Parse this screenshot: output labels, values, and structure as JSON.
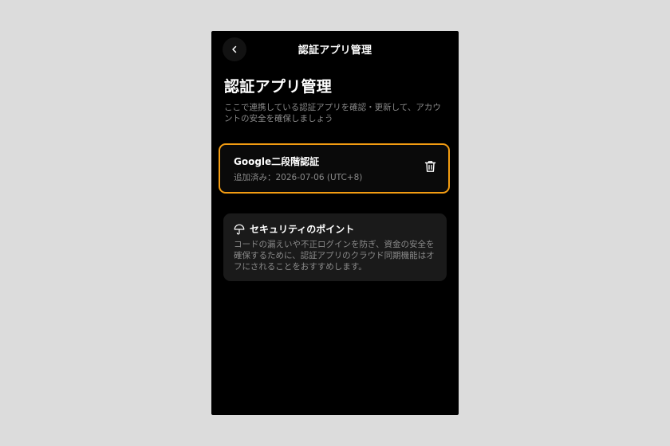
{
  "header": {
    "title": "認証アプリ管理"
  },
  "main": {
    "title": "認証アプリ管理",
    "description": "ここで連携している認証アプリを確認・更新して、アカウントの安全を確保しましょう"
  },
  "authenticator": {
    "name": "Google二段階認証",
    "added": "追加済み：2026-07-06 (UTC+8)"
  },
  "security_tips": {
    "title": "セキュリティのポイント",
    "body": "コードの漏えいや不正ログインを防ぎ、資金の安全を確保するために、認証アプリのクラウド同期機能はオフにされることをおすすめします。"
  },
  "colors": {
    "background": "#000000",
    "highlight_border": "#f39c12",
    "card_background": "#1a1a1a",
    "muted_text": "#8a8a8a"
  },
  "icons": {
    "back": "chevron-left-icon",
    "delete": "trash-icon",
    "tips": "umbrella-icon"
  }
}
